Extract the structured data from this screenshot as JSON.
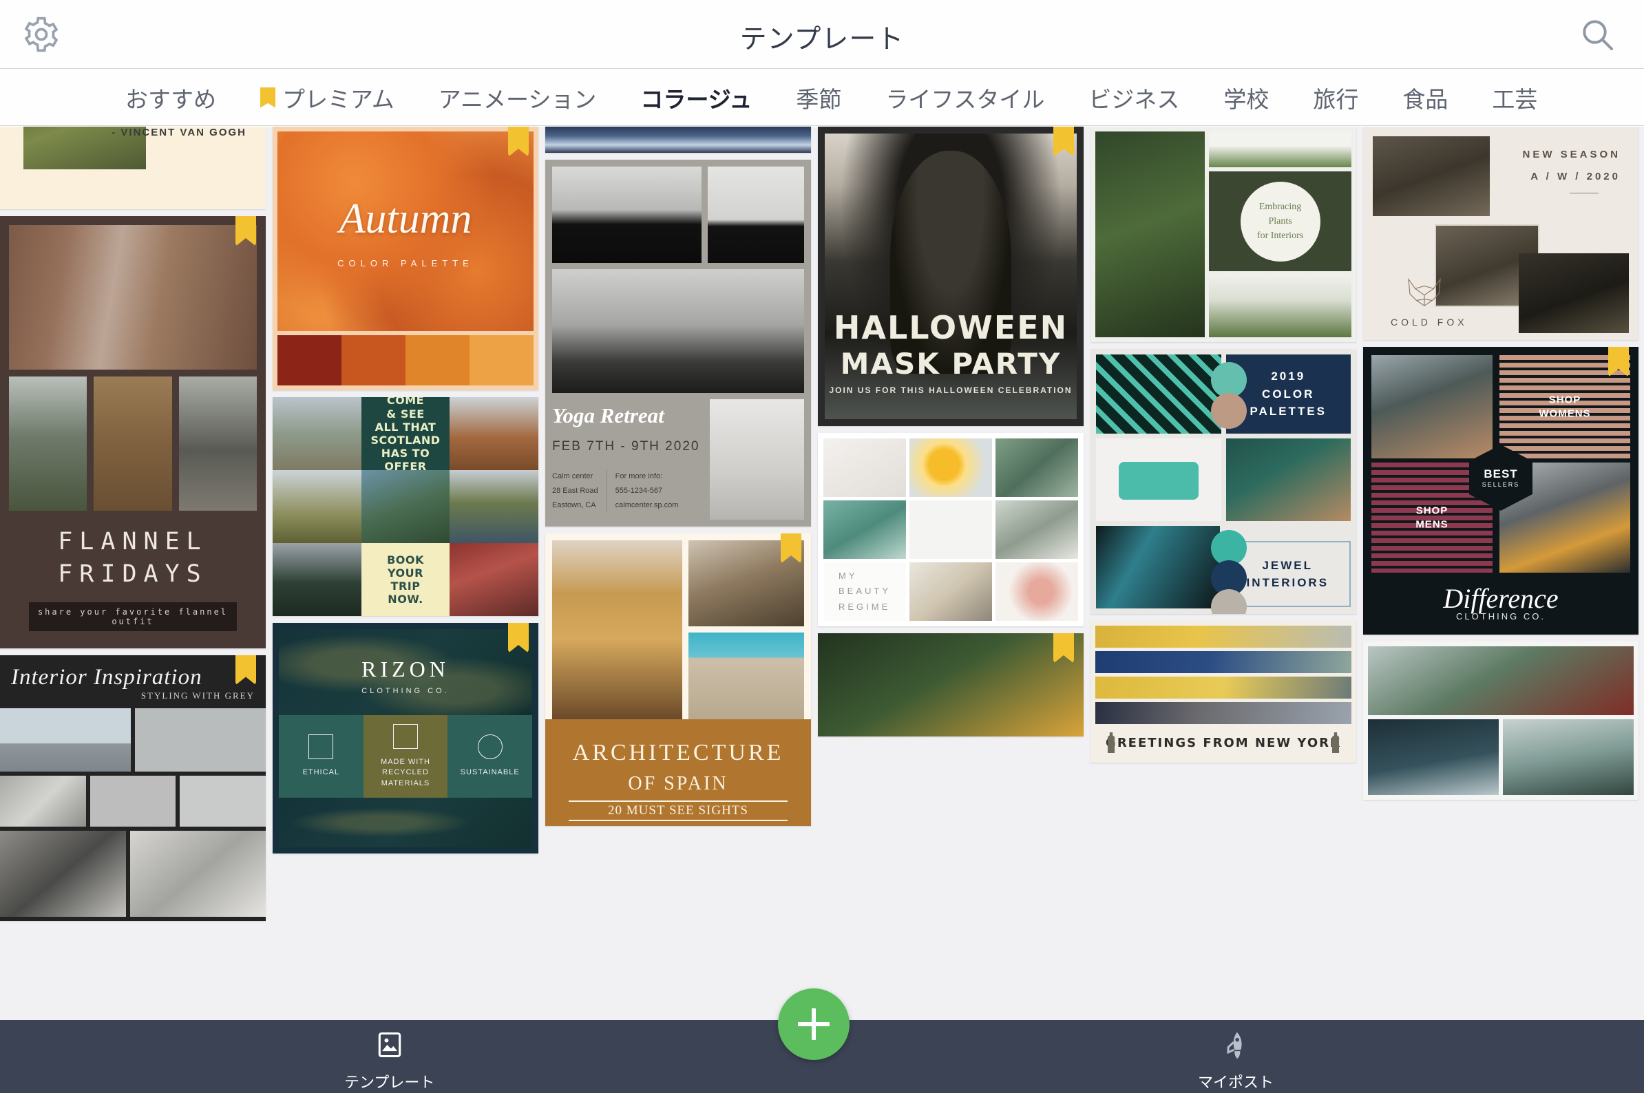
{
  "header": {
    "title": "テンプレート",
    "gear_icon": "gear-icon",
    "search_icon": "search-icon"
  },
  "tabs": [
    {
      "label": "おすすめ",
      "active": false,
      "premium": false
    },
    {
      "label": "プレミアム",
      "active": false,
      "premium": true
    },
    {
      "label": "アニメーション",
      "active": false,
      "premium": false
    },
    {
      "label": "コラージュ",
      "active": true,
      "premium": false
    },
    {
      "label": "季節",
      "active": false,
      "premium": false
    },
    {
      "label": "ライフスタイル",
      "active": false,
      "premium": false
    },
    {
      "label": "ビジネス",
      "active": false,
      "premium": false
    },
    {
      "label": "学校",
      "active": false,
      "premium": false
    },
    {
      "label": "旅行",
      "active": false,
      "premium": false
    },
    {
      "label": "食品",
      "active": false,
      "premium": false
    },
    {
      "label": "工芸",
      "active": false,
      "premium": false
    }
  ],
  "templates": {
    "vangogh": {
      "quote_author": "- VINCENT VAN GOGH"
    },
    "flannel": {
      "title_line1": "FLANNEL",
      "title_line2": "FRIDAYS",
      "subtitle": "share your favorite flannel outfit"
    },
    "interior": {
      "title": "Interior Inspiration",
      "subtitle": "STYLING WITH GREY"
    },
    "autumn": {
      "title": "Autumn",
      "subtitle": "COLOR PALETTE",
      "swatches": [
        "#8c2518",
        "#c8561f",
        "#e08529",
        "#eda245"
      ]
    },
    "scotland": {
      "headline": "COME\n& SEE\nALL THAT\nSCOTLAND\nHAS TO\nOFFER",
      "cta": "BOOK\nYOUR\nTRIP\nNOW."
    },
    "rizon": {
      "brand": "RIZON",
      "brand_sub": "CLOTHING CO.",
      "features": [
        "ETHICAL",
        "MADE WITH\nRECYCLED MATERIALS",
        "SUSTAINABLE"
      ]
    },
    "yoga": {
      "title": "Yoga Retreat",
      "dates": "FEB 7TH - 9TH 2020",
      "venue": "Calm center\n28 East Road\nEastown, CA",
      "contact": "For more info:\n555-1234-567\ncalmcenter.sp.com"
    },
    "architecture": {
      "line1": "ARCHITECTURE",
      "line2": "OF SPAIN",
      "line3": "20 MUST SEE SIGHTS"
    },
    "halloween": {
      "line1": "HALLOWEEN",
      "line2": "MASK PARTY",
      "line3": "JOIN US FOR THIS HALLOWEEN CELEBRATION"
    },
    "beauty": {
      "label": "MY\nBEAUTY\nREGIME"
    },
    "plants": {
      "circle_text": "Embracing\nPlants\nfor Interiors"
    },
    "jewel": {
      "palettes_label": "2019\nCOLOR\nPALETTES",
      "box_label": "JEWEL\nINTERIORS"
    },
    "newyork": {
      "caption": "GREETINGS FROM NEW YORK"
    },
    "coldfox": {
      "season": "NEW SEASON",
      "season_code": "A / W / 2020",
      "brand": "COLD FOX"
    },
    "difference": {
      "shop_womens": "SHOP\nWOMENS",
      "shop_mens": "SHOP\nMENS",
      "best": "BEST",
      "sellers": "SELLERS",
      "brand": "Difference",
      "brand_sub": "CLOTHING CO."
    }
  },
  "bottom_nav": {
    "templates_label": "テンプレート",
    "templates_icon": "image-template-icon",
    "myposts_label": "マイポスト",
    "myposts_icon": "rocket-icon",
    "create_icon": "plus-icon",
    "create_color": "#5cbd5f"
  },
  "colors": {
    "premium_badge": "#f2c231",
    "bottom_bar": "#3c4354",
    "grid_bg": "#f1f1f3",
    "active_tab": "#1d2330",
    "inactive_tab": "#5e6470"
  }
}
